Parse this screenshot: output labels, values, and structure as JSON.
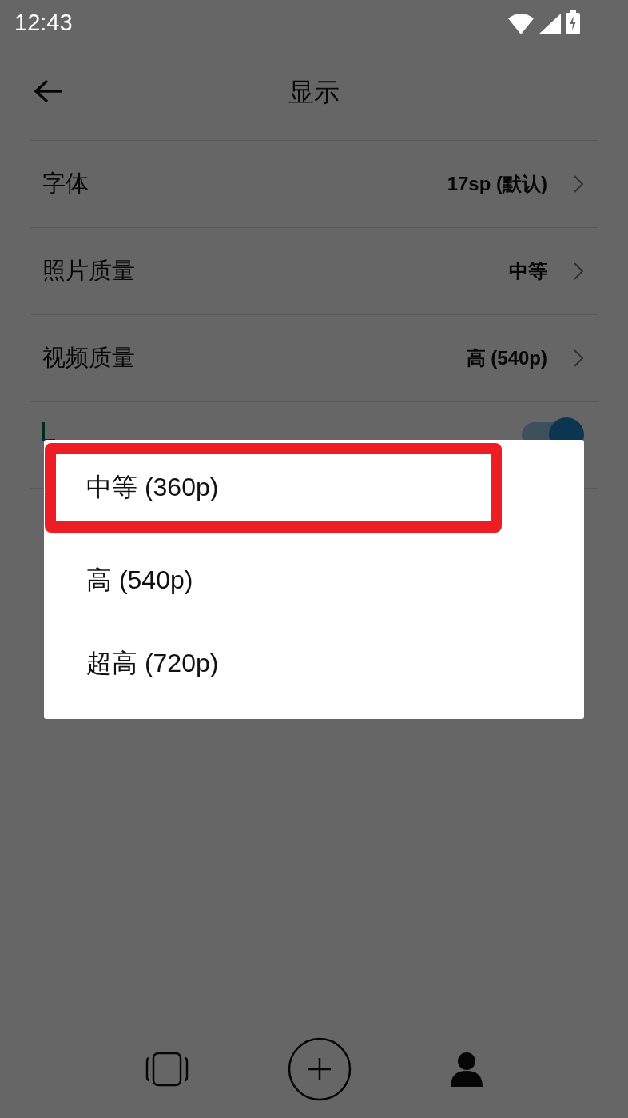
{
  "status_bar": {
    "time": "12:43"
  },
  "header": {
    "title": "显示"
  },
  "settings": [
    {
      "kind": "value",
      "label": "字体",
      "value": "17sp (默认)"
    },
    {
      "kind": "value",
      "label": "照片质量",
      "value": "中等"
    },
    {
      "kind": "value",
      "label": "视频质量",
      "value": "高 (540p)"
    },
    {
      "kind": "toggle",
      "on": true
    }
  ],
  "dialog": {
    "options": [
      {
        "label": "中等 (360p)",
        "highlighted": true
      },
      {
        "label": "高 (540p)",
        "highlighted": false
      },
      {
        "label": "超高 (720p)",
        "highlighted": false
      }
    ]
  }
}
